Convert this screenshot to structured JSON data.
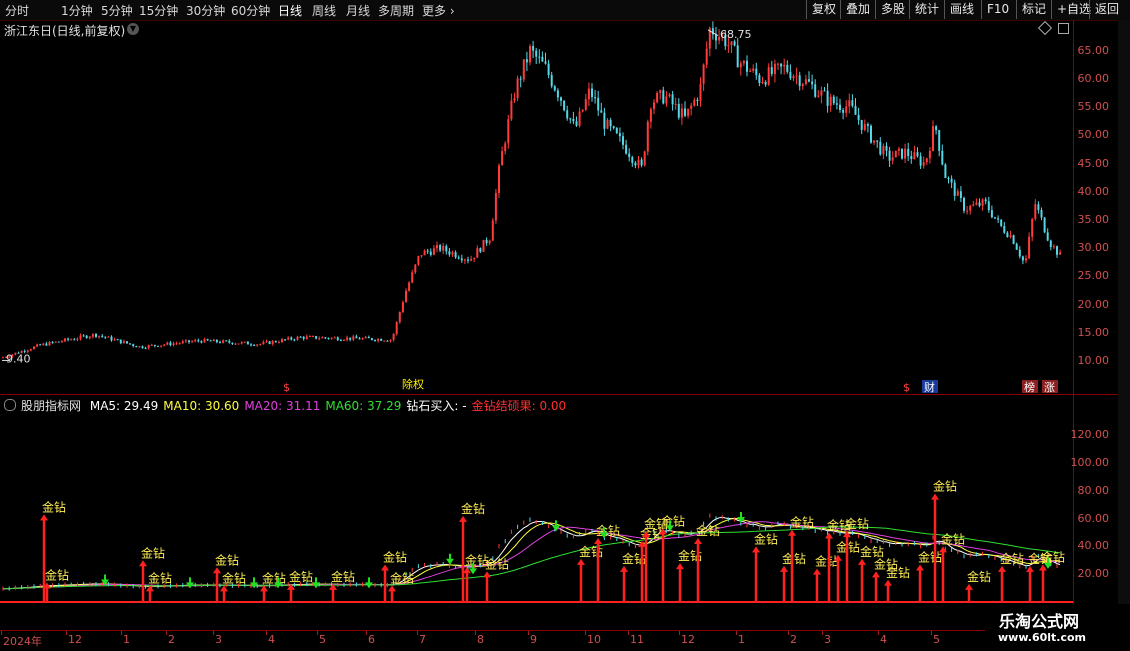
{
  "toolbar": {
    "periods": [
      "分时",
      "1分钟",
      "5分钟",
      "15分钟",
      "30分钟",
      "60分钟",
      "日线",
      "周线",
      "月线",
      "多周期",
      "更多"
    ],
    "active_period": "日线",
    "buttons": [
      "复权",
      "叠加",
      "多股",
      "统计",
      "画线",
      "F10",
      "标记",
      "+自选",
      "返回"
    ]
  },
  "stock": {
    "title": "浙江东日(日线,前复权)"
  },
  "price_chart": {
    "y_ticks": [
      "65.00",
      "60.00",
      "55.00",
      "50.00",
      "45.00",
      "40.00",
      "35.00",
      "30.00",
      "25.00",
      "20.00",
      "15.00",
      "10.00"
    ],
    "high_label": "68.75",
    "low_label": "9.40",
    "event_marks": [
      "$",
      "$",
      "财",
      "榜",
      "涨"
    ],
    "event_mark_split": "除权",
    "colors": {
      "up": "#ff3b3b",
      "down": "#54d8e8"
    }
  },
  "indicator": {
    "name": "股朋指标网",
    "legend": [
      {
        "label": "MA5: 29.49",
        "color": "#ffffff"
      },
      {
        "label": "MA10: 30.60",
        "color": "#ffff40"
      },
      {
        "label": "MA20: 31.11",
        "color": "#e040e0"
      },
      {
        "label": "MA60: 37.29",
        "color": "#30e030"
      },
      {
        "label": "钻石买入: -",
        "color": "#ffffff"
      },
      {
        "label": "金钻结硕果: 0.00",
        "color": "#ff3030"
      }
    ],
    "y_ticks": [
      "120.00",
      "100.00",
      "80.00",
      "60.00",
      "40.00",
      "20.00"
    ],
    "signal_label": "金钻"
  },
  "time_axis": [
    "2024年",
    "12",
    "1",
    "2",
    "3",
    "4",
    "5",
    "6",
    "7",
    "8",
    "9",
    "10",
    "11",
    "12",
    "1",
    "2",
    "3",
    "4",
    "5"
  ],
  "watermark": {
    "title": "乐淘公式网",
    "url": "www.60lt.com"
  }
}
